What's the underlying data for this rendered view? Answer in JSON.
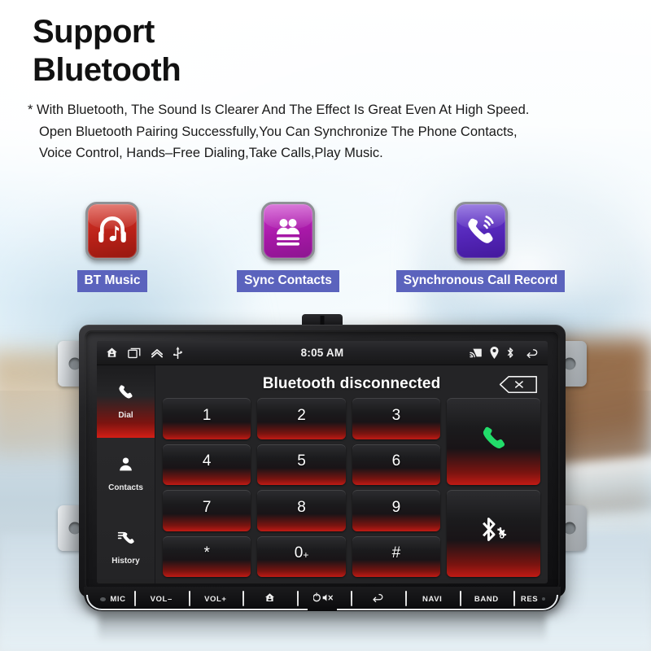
{
  "header": {
    "title_line1": "Support",
    "title_line2": "Bluetooth",
    "desc_line1": "* With Bluetooth, The Sound Is Clearer And The Effect Is Great Even At High Speed.",
    "desc_line2": "Open Bluetooth Pairing Successfully,You Can Synchronize The Phone Contacts,",
    "desc_line3": "Voice Control, Hands–Free Dialing,Take Calls,Play Music."
  },
  "features": [
    {
      "label": "BT Music",
      "icon": "headphones-music-icon",
      "color": "#b92118"
    },
    {
      "label": "Sync Contacts",
      "icon": "contacts-card-icon",
      "color": "#a718a7"
    },
    {
      "label": "Synchronous Call Record",
      "icon": "phone-waves-icon",
      "color": "#5426b8"
    }
  ],
  "head_unit": {
    "status_bar": {
      "time": "8:05 AM",
      "left_icons": [
        "home-icon",
        "recent-apps-icon",
        "chevron-up-icon",
        "usb-icon"
      ],
      "right_icons": [
        "screen-cast-icon",
        "location-pin-icon",
        "bluetooth-icon",
        "back-arrow-icon"
      ]
    },
    "sidebar": [
      {
        "label": "Dial",
        "icon": "phone-handset-icon",
        "active": true
      },
      {
        "label": "Contacts",
        "icon": "person-icon",
        "active": false
      },
      {
        "label": "History",
        "icon": "call-history-icon",
        "active": false
      }
    ],
    "panel": {
      "title": "Bluetooth disconnected",
      "backspace_icon": "backspace-close-icon"
    },
    "keypad": [
      {
        "label": "1"
      },
      {
        "label": "2"
      },
      {
        "label": "3"
      },
      {
        "label": "4"
      },
      {
        "label": "5"
      },
      {
        "label": "6"
      },
      {
        "label": "7"
      },
      {
        "label": "8"
      },
      {
        "label": "9"
      },
      {
        "label": "*"
      },
      {
        "label": "0",
        "sup": "+"
      },
      {
        "label": "#"
      }
    ],
    "action_keys": [
      {
        "name": "call-button",
        "icon": "green-phone-icon"
      },
      {
        "name": "bluetooth-settings-button",
        "icon": "bluetooth-gear-icon"
      }
    ],
    "hardware_buttons": [
      {
        "label": "MIC",
        "icon": "mic-icon"
      },
      {
        "label": "VOL–",
        "icon": ""
      },
      {
        "label": "VOL+",
        "icon": ""
      },
      {
        "label": "",
        "icon": "home-icon"
      },
      {
        "label": "",
        "icon": "power-mute-icon"
      },
      {
        "label": "",
        "icon": "back-arrow-icon"
      },
      {
        "label": "NAVI",
        "icon": ""
      },
      {
        "label": "BAND",
        "icon": ""
      },
      {
        "label": "RES",
        "icon": "reset-dot-icon"
      }
    ]
  },
  "colors": {
    "badge_blue": "#5b63bd",
    "key_red_glow": "#c01a14",
    "call_green": "#22dd6a"
  }
}
